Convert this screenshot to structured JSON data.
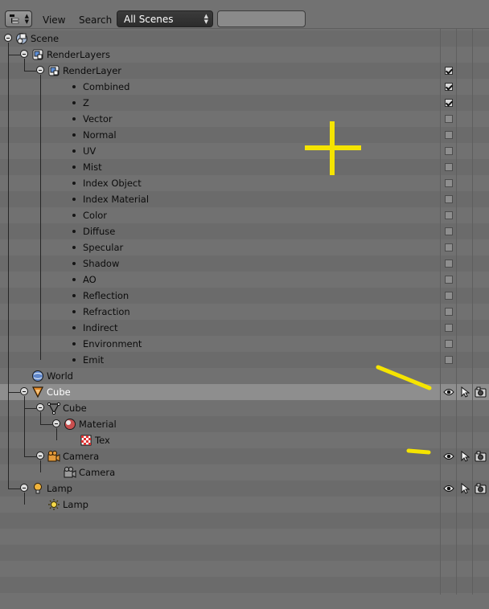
{
  "header": {
    "editor_type_icon": "outliner-icon",
    "menus": [
      "View",
      "Search"
    ],
    "display_mode": "All Scenes",
    "search": {
      "icon": "search-icon",
      "value": ""
    }
  },
  "tree": [
    {
      "label": "Scene",
      "depth": 0,
      "icon": "scene-icon",
      "expanded": true
    },
    {
      "label": "RenderLayers",
      "depth": 1,
      "icon": "renderlayers-icon",
      "expanded": true
    },
    {
      "label": "RenderLayer",
      "depth": 2,
      "icon": "renderlayer-icon",
      "expanded": true,
      "checked": true
    },
    {
      "label": "Combined",
      "depth": 3,
      "pass": true,
      "checked": true
    },
    {
      "label": "Z",
      "depth": 3,
      "pass": true,
      "checked": true
    },
    {
      "label": "Vector",
      "depth": 3,
      "pass": true,
      "checked": false
    },
    {
      "label": "Normal",
      "depth": 3,
      "pass": true,
      "checked": false
    },
    {
      "label": "UV",
      "depth": 3,
      "pass": true,
      "checked": false
    },
    {
      "label": "Mist",
      "depth": 3,
      "pass": true,
      "checked": false
    },
    {
      "label": "Index Object",
      "depth": 3,
      "pass": true,
      "checked": false
    },
    {
      "label": "Index Material",
      "depth": 3,
      "pass": true,
      "checked": false
    },
    {
      "label": "Color",
      "depth": 3,
      "pass": true,
      "checked": false
    },
    {
      "label": "Diffuse",
      "depth": 3,
      "pass": true,
      "checked": false
    },
    {
      "label": "Specular",
      "depth": 3,
      "pass": true,
      "checked": false
    },
    {
      "label": "Shadow",
      "depth": 3,
      "pass": true,
      "checked": false
    },
    {
      "label": "AO",
      "depth": 3,
      "pass": true,
      "checked": false
    },
    {
      "label": "Reflection",
      "depth": 3,
      "pass": true,
      "checked": false
    },
    {
      "label": "Refraction",
      "depth": 3,
      "pass": true,
      "checked": false
    },
    {
      "label": "Indirect",
      "depth": 3,
      "pass": true,
      "checked": false
    },
    {
      "label": "Environment",
      "depth": 3,
      "pass": true,
      "checked": false
    },
    {
      "label": "Emit",
      "depth": 3,
      "pass": true,
      "checked": false
    },
    {
      "label": "World",
      "depth": 1,
      "icon": "world-icon"
    },
    {
      "label": "Cube",
      "depth": 1,
      "icon": "object-icon",
      "expanded": true,
      "selected": true,
      "restrict": true
    },
    {
      "label": "Cube",
      "depth": 2,
      "icon": "mesh-icon",
      "expanded": true
    },
    {
      "label": "Material",
      "depth": 3,
      "icon": "material-icon",
      "expanded": true
    },
    {
      "label": "Tex",
      "depth": 4,
      "icon": "texture-icon"
    },
    {
      "label": "Camera",
      "depth": 2,
      "icon": "camera-object-icon",
      "expanded": true,
      "restrict": true
    },
    {
      "label": "Camera",
      "depth": 3,
      "icon": "camera-data-icon"
    },
    {
      "label": "Lamp",
      "depth": 1,
      "icon": "lamp-object-icon",
      "expanded": true,
      "restrict": true
    },
    {
      "label": "Lamp",
      "depth": 2,
      "icon": "lamp-data-icon"
    }
  ],
  "restrict_icons": [
    "eye-icon",
    "cursor-icon",
    "camera-render-icon"
  ],
  "colors": {
    "annotation": "#f5e400",
    "selection": "#8e8e8e",
    "background": "#717171"
  }
}
